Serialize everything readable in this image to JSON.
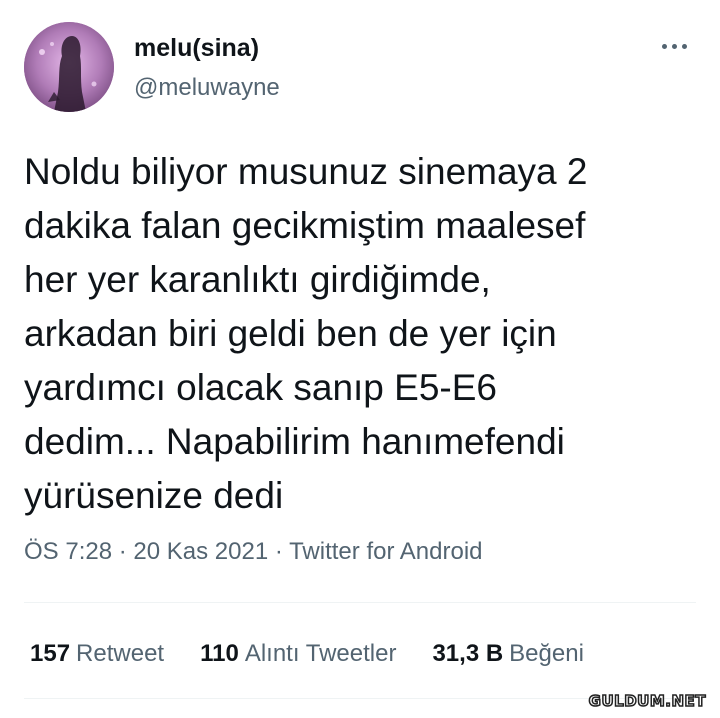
{
  "author": {
    "name": "melu(sina)",
    "handle": "@meluwayne",
    "avatar_icon": "profile-photo"
  },
  "tweet": {
    "lines": [
      "Noldu biliyor musunuz sinemaya 2",
      "dakika falan gecikmiştim maalesef",
      "her yer karanlıktı girdiğimde,",
      "arkadan biri geldi ben de yer için",
      "yardımcı olacak sanıp E5-E6",
      "dedim... Napabilirim hanımefendi",
      "yürüsenize dedi"
    ]
  },
  "meta": {
    "time": "ÖS 7:28",
    "separator": "·",
    "date": "20 Kas 2021",
    "source": "Twitter for Android"
  },
  "stats": {
    "retweets": {
      "count": "157",
      "label": "Retweet"
    },
    "quotes": {
      "count": "110",
      "label": "Alıntı Tweetler"
    },
    "likes": {
      "count": "31,3 B",
      "label": "Beğeni"
    }
  },
  "more_icon": "more-horizontal-icon",
  "watermark": "GULDUM.NET",
  "colors": {
    "text": "#0f1419",
    "secondary": "#536471",
    "divider": "#eff3f4"
  }
}
